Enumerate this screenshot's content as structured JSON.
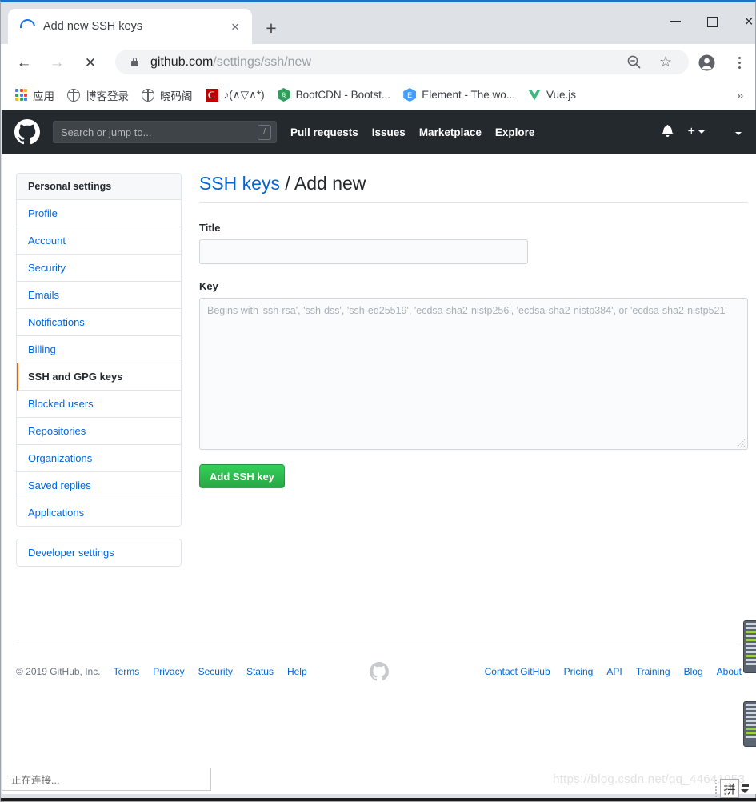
{
  "browser": {
    "tab": {
      "title": "Add new SSH keys",
      "favicon": "loading-spinner-icon",
      "close": "×"
    },
    "new_tab": "+",
    "window_controls": {
      "minimize": "minimize-icon",
      "maximize": "maximize-icon",
      "close": "×"
    },
    "nav": {
      "back": "←",
      "forward": "→",
      "stop": "✕"
    },
    "omnibox": {
      "url_domain": "github.com",
      "url_path": "/settings/ssh/new",
      "full_url": "github.com/settings/ssh/new",
      "lock": "lock-icon",
      "zoom_out": "zoom-out-icon",
      "star": "☆"
    },
    "bookmarks": [
      {
        "label": "应用",
        "icon": "apps-grid-icon"
      },
      {
        "label": "博客登录",
        "icon": "globe-icon"
      },
      {
        "label": "晓码阁",
        "icon": "globe-icon"
      },
      {
        "label": "♪(∧▽∧*)",
        "icon": "c-square-icon",
        "icon_text": "C",
        "icon_color": "#c00000"
      },
      {
        "label": "BootCDN - Bootst...",
        "icon": "hexagon-icon",
        "icon_text": "§",
        "icon_color": "#2e9e5b"
      },
      {
        "label": "Element - The wo...",
        "icon": "hexagon-icon",
        "icon_text": "E",
        "icon_color": "#409eff"
      },
      {
        "label": "Vue.js",
        "icon": "vue-logo-icon",
        "icon_color": "#41b883"
      }
    ],
    "bookmarks_overflow": "»",
    "status_text": "正在连接...",
    "watermark": "https://blog.csdn.net/qq_44641953"
  },
  "ime": {
    "pinyin_label": "拼"
  },
  "github": {
    "header": {
      "logo": "github-logo-icon",
      "search_placeholder": "Search or jump to...",
      "search_shortcut": "/",
      "nav": [
        {
          "label": "Pull requests"
        },
        {
          "label": "Issues"
        },
        {
          "label": "Marketplace"
        },
        {
          "label": "Explore"
        }
      ],
      "notifications": "bell-icon",
      "create_new": "+",
      "profile": "profile-caret"
    },
    "sidebar": {
      "heading": "Personal settings",
      "items": [
        {
          "label": "Profile",
          "active": false
        },
        {
          "label": "Account",
          "active": false
        },
        {
          "label": "Security",
          "active": false
        },
        {
          "label": "Emails",
          "active": false
        },
        {
          "label": "Notifications",
          "active": false
        },
        {
          "label": "Billing",
          "active": false
        },
        {
          "label": "SSH and GPG keys",
          "active": true
        },
        {
          "label": "Blocked users",
          "active": false
        },
        {
          "label": "Repositories",
          "active": false
        },
        {
          "label": "Organizations",
          "active": false
        },
        {
          "label": "Saved replies",
          "active": false
        },
        {
          "label": "Applications",
          "active": false
        }
      ],
      "developer_settings": "Developer settings"
    },
    "main": {
      "heading_link": "SSH keys",
      "heading_separator": "/",
      "heading_current": "Add new",
      "title_label": "Title",
      "title_value": "",
      "title_placeholder": "",
      "key_label": "Key",
      "key_value": "",
      "key_placeholder": "Begins with 'ssh-rsa', 'ssh-dss', 'ssh-ed25519', 'ecdsa-sha2-nistp256', 'ecdsa-sha2-nistp384', or 'ecdsa-sha2-nistp521'",
      "submit_label": "Add SSH key",
      "submit_color": "#28a745"
    },
    "footer": {
      "copyright": "© 2019 GitHub, Inc.",
      "left_links": [
        {
          "label": "Terms"
        },
        {
          "label": "Privacy"
        },
        {
          "label": "Security"
        },
        {
          "label": "Status"
        },
        {
          "label": "Help"
        }
      ],
      "mark": "github-mark-icon",
      "right_links": [
        {
          "label": "Contact GitHub"
        },
        {
          "label": "Pricing"
        },
        {
          "label": "API"
        },
        {
          "label": "Training"
        },
        {
          "label": "Blog"
        },
        {
          "label": "About"
        }
      ]
    }
  }
}
